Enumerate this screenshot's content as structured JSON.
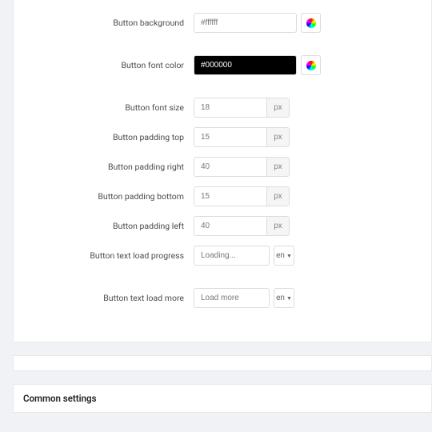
{
  "fields": {
    "button_background": {
      "label": "Button background",
      "value": "#ffffff"
    },
    "button_font_color": {
      "label": "Button font color",
      "value": "#000000"
    },
    "button_font_size": {
      "label": "Button font size",
      "value": "18",
      "unit": "px"
    },
    "button_padding_top": {
      "label": "Button padding top",
      "value": "15",
      "unit": "px"
    },
    "button_padding_right": {
      "label": "Button padding right",
      "value": "40",
      "unit": "px"
    },
    "button_padding_bottom": {
      "label": "Button padding bottom",
      "value": "15",
      "unit": "px"
    },
    "button_padding_left": {
      "label": "Button padding left",
      "value": "40",
      "unit": "px"
    },
    "button_text_load_progress": {
      "label": "Button text load progress",
      "value": "Loading...",
      "lang": "en"
    },
    "button_text_load_more": {
      "label": "Button text load more",
      "value": "Load more",
      "lang": "en"
    }
  },
  "section_title": "Common settings"
}
